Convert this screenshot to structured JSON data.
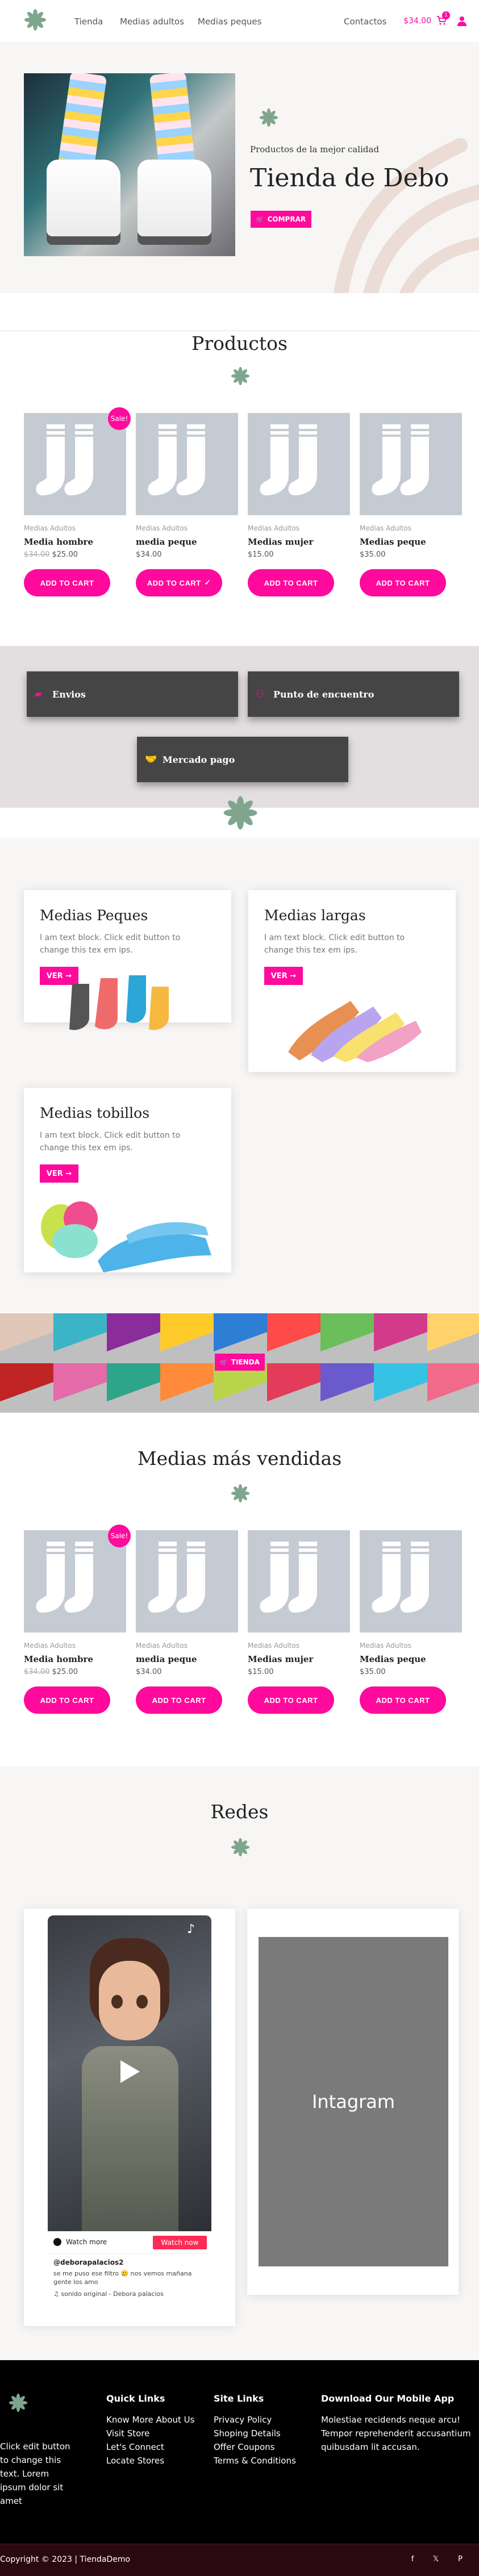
{
  "header": {
    "nav": [
      "Tienda",
      "Medias adultos",
      "Medias peques"
    ],
    "contactos": "Contactos",
    "cart_total": "$34.00",
    "cart_count": "1"
  },
  "hero": {
    "subtitle": "Productos de la mejor calidad",
    "title": "Tienda de Debo",
    "button": "COMPRAR"
  },
  "productos": {
    "title": "Productos",
    "items": [
      {
        "category": "Medias Adultos",
        "name": "Media hombre",
        "old_price": "$34.00",
        "price": "$25.00",
        "button": "ADD TO CART",
        "sale": "Sale!"
      },
      {
        "category": "Medias Adultos",
        "name": "media peque",
        "price": "$34.00",
        "button": "ADD TO CART"
      },
      {
        "category": "Medias Adultos",
        "name": "Medias mujer",
        "price": "$15.00",
        "button": "ADD TO CART"
      },
      {
        "category": "Medias Adultos",
        "name": "Medias peque",
        "price": "$35.00",
        "button": "ADD TO CART"
      }
    ]
  },
  "services": {
    "envios": "Envios",
    "encuentro": "Punto de encuentro",
    "mercado": "Mercado pago"
  },
  "categories": [
    {
      "title": "Medias Peques",
      "text": "I am text block. Click edit button to change this tex em ips.",
      "button": "VER"
    },
    {
      "title": "Medias largas",
      "text": "I am text block. Click edit button to change this tex em ips.",
      "button": "VER"
    },
    {
      "title": "Medias tobillos",
      "text": "I am text block. Click edit button to change this tex em ips.",
      "button": "VER"
    }
  ],
  "banner": {
    "button": "TIENDA"
  },
  "vendidas": {
    "title": "Medias más vendidas",
    "items": [
      {
        "category": "Medias Adultos",
        "name": "Media hombre",
        "old_price": "$34.00",
        "price": "$25.00",
        "button": "ADD TO CART",
        "sale": "Sale!"
      },
      {
        "category": "Medias Adultos",
        "name": "media peque",
        "price": "$34.00",
        "button": "ADD TO CART"
      },
      {
        "category": "Medias Adultos",
        "name": "Medias mujer",
        "price": "$15.00",
        "button": "ADD TO CART"
      },
      {
        "category": "Medias Adultos",
        "name": "Medias peque",
        "price": "$35.00",
        "button": "ADD TO CART"
      }
    ]
  },
  "redes": {
    "title": "Redes",
    "watch_more": "Watch more",
    "watch_now": "Watch now",
    "handle": "@deborapalacios2",
    "caption": "se me puso ese filtro 🥲 nos vemos mañana gente los amo",
    "sound": "sonido original - Debora palacios",
    "instagram": "Intagram"
  },
  "footer": {
    "about": "Click edit button to change this text. Lorem ipsum dolor sit amet",
    "quick_links_title": "Quick Links",
    "quick_links": [
      "Know More About Us",
      "Visit Store",
      "Let's Connect",
      "Locate Stores"
    ],
    "site_links_title": "Site Links",
    "site_links": [
      "Privacy Policy",
      "Shoping Details",
      "Offer Coupons",
      "Terms & Conditions"
    ],
    "app_title": "Download Our Mobile App",
    "app_text": "Molestiae recidends neque arcu! Tempor reprehenderit accusantium quibusdam lit accusan.",
    "copyright": "Copyright © 2023 | TiendaDemo"
  },
  "colors": {
    "accent": "#ff0a9c",
    "dark_box": "#454545",
    "card_gray": "#c5cbd2",
    "flower": "#7fa58e"
  }
}
